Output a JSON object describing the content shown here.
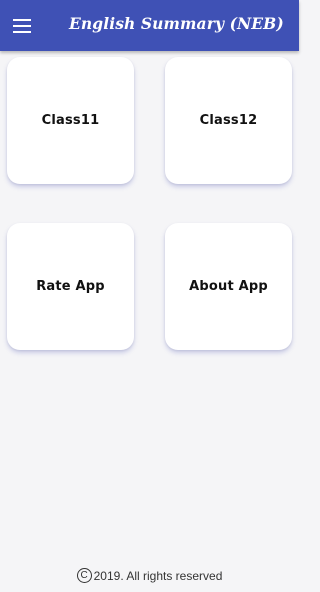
{
  "appbar": {
    "title": "English Summary (NEB)",
    "menu_icon": "hamburger-menu-icon",
    "background": "#3f51b5"
  },
  "cards": [
    {
      "label": "Class11"
    },
    {
      "label": "Class12"
    },
    {
      "label": "Rate App"
    },
    {
      "label": "About App"
    }
  ],
  "footer": {
    "icon": "copyright-icon",
    "icon_glyph": "C",
    "text": "2019. All rights reserved"
  }
}
